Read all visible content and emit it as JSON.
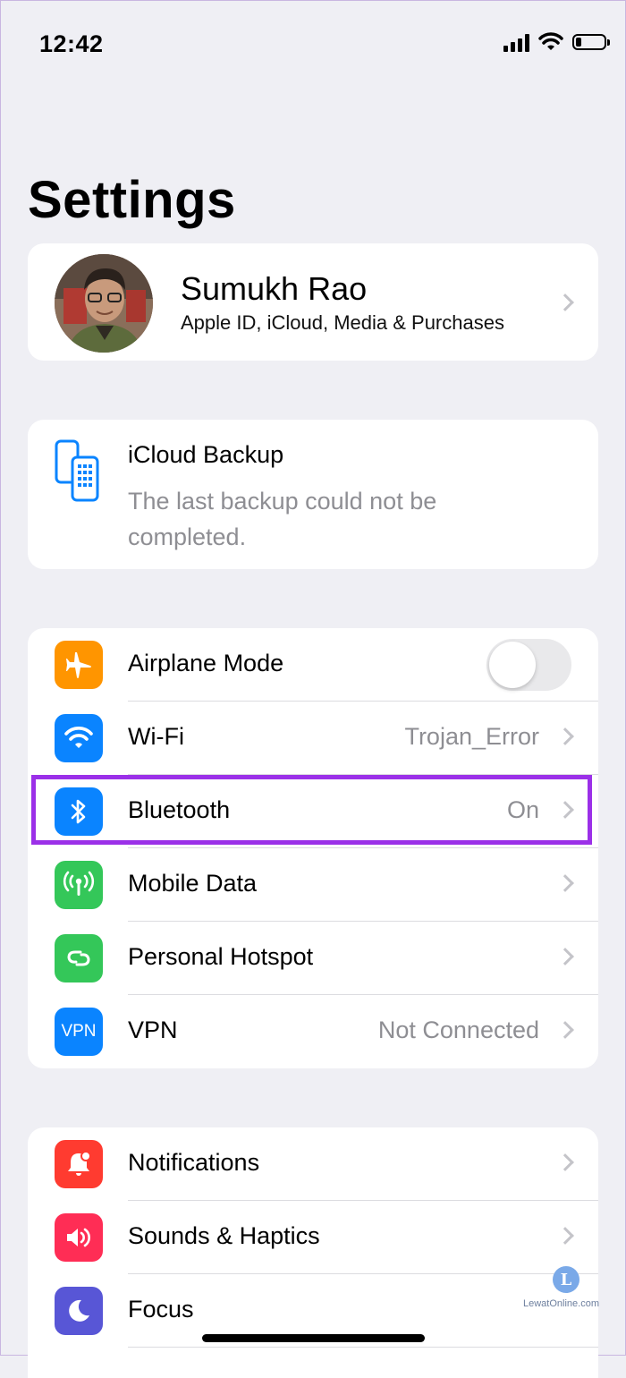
{
  "status_bar": {
    "time": "12:42",
    "icons": [
      "signal-icon",
      "wifi-icon",
      "battery-icon"
    ],
    "battery_level": 0.2
  },
  "header": {
    "title": "Settings"
  },
  "profile": {
    "name": "Sumukh Rao",
    "subtitle": "Apple ID, iCloud, Media & Purchases"
  },
  "backup": {
    "title": "iCloud Backup",
    "message": "The last backup could not be completed."
  },
  "connectivity": [
    {
      "label": "Airplane Mode",
      "value": "",
      "icon": "airplane-icon",
      "color": "#ff9500",
      "control": "toggle",
      "on": false
    },
    {
      "label": "Wi-Fi",
      "value": "Trojan_Error",
      "icon": "wifi-icon",
      "color": "#0a84ff"
    },
    {
      "label": "Bluetooth",
      "value": "On",
      "icon": "bluetooth-icon",
      "color": "#0a84ff",
      "highlighted": true,
      "highlight_color": "#9b30e8"
    },
    {
      "label": "Mobile Data",
      "value": "",
      "icon": "antenna-icon",
      "color": "#34c759"
    },
    {
      "label": "Personal Hotspot",
      "value": "",
      "icon": "hotspot-icon",
      "color": "#34c759"
    },
    {
      "label": "VPN",
      "value": "Not Connected",
      "icon": "vpn-icon",
      "color": "#0a84ff"
    }
  ],
  "general": [
    {
      "label": "Notifications",
      "icon": "bell-icon",
      "color": "#ff3b30"
    },
    {
      "label": "Sounds & Haptics",
      "icon": "speaker-icon",
      "color": "#ff2d55"
    },
    {
      "label": "Focus",
      "icon": "moon-icon",
      "color": "#5856d6"
    }
  ],
  "watermark": {
    "mark": "L",
    "text": "LewatOnline.com"
  }
}
